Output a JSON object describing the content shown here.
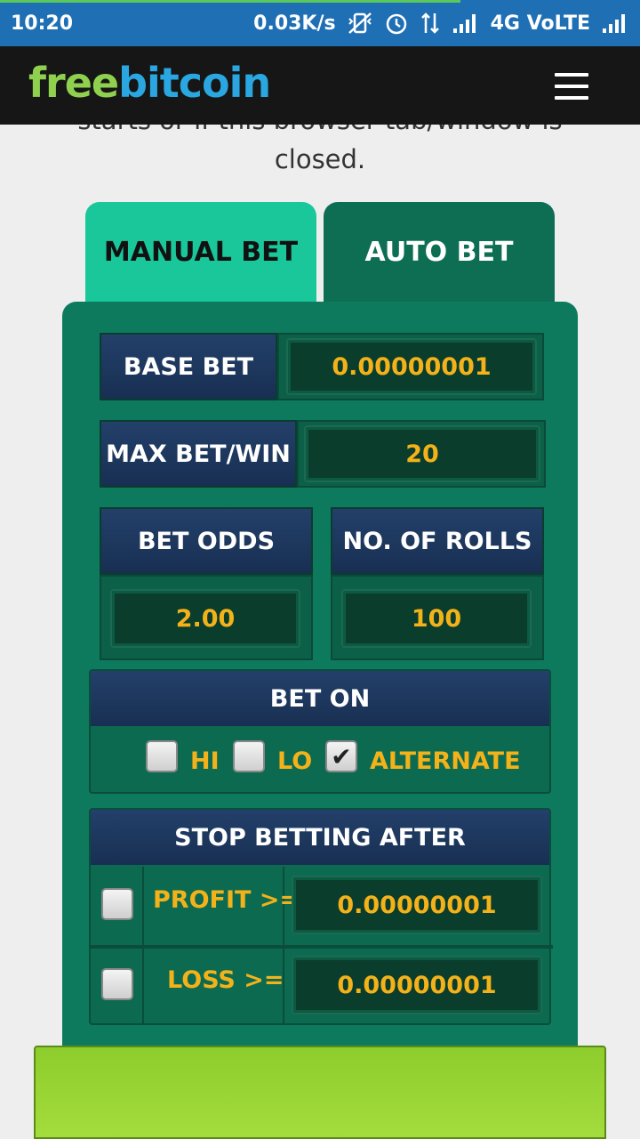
{
  "status_bar": {
    "time": "10:20",
    "speed": "0.03K/s",
    "network": "4G VoLTE",
    "icons": [
      "vibrate-off-icon",
      "alarm-icon",
      "data-arrows-icon",
      "signal-icon",
      "signal-icon"
    ]
  },
  "header": {
    "logo_free": "free",
    "logo_bitcoin": "bitcoin",
    "menu_icon": "hamburger-icon"
  },
  "intro": {
    "line1": "starts or if this browser tab/window is",
    "line2": "closed."
  },
  "tabs": [
    {
      "label": "MANUAL BET",
      "active": true
    },
    {
      "label": "AUTO BET",
      "active": false
    }
  ],
  "auto_bet": {
    "base_bet_label": "BASE BET",
    "base_bet_value": "0.00000001",
    "max_bet_label": "MAX BET/WIN",
    "max_bet_value": "20",
    "bet_odds_label": "BET ODDS",
    "bet_odds_value": "2.00",
    "rolls_label": "NO. OF ROLLS",
    "rolls_value": "100",
    "bet_on": {
      "title": "BET ON",
      "options": [
        {
          "label": "HI",
          "checked": false
        },
        {
          "label": "LO",
          "checked": false
        },
        {
          "label": "ALTERNATE",
          "checked": true
        }
      ]
    },
    "stop_after": {
      "title": "STOP BETTING AFTER",
      "profit_label": "PROFIT >=",
      "profit_value": "0.00000001",
      "profit_checked": false,
      "loss_label": "LOSS >=",
      "loss_value": "0.00000001",
      "loss_checked": false
    }
  },
  "colors": {
    "status_bar": "#1f6fb5",
    "nav": "#161616",
    "logo_green": "#8fd14f",
    "logo_blue": "#2aa7e0",
    "panel_green": "#0e7a5d",
    "active_tab": "#19c79a",
    "label_navy": "#1d3760",
    "value_gold": "#f3b21a",
    "action_bar": "#9ad635"
  }
}
